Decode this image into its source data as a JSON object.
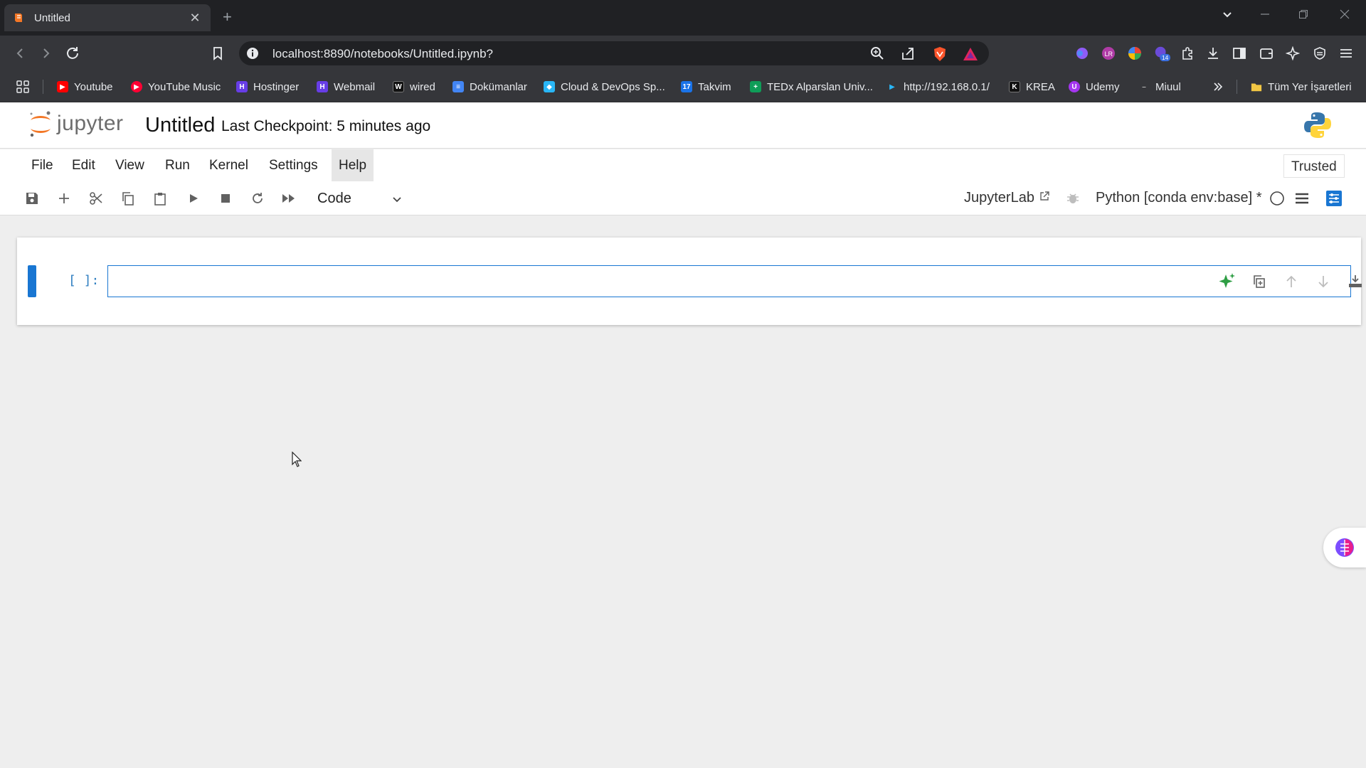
{
  "browser": {
    "tab": {
      "title": "Untitled"
    },
    "url": "localhost:8890/notebooks/Untitled.ipynb?",
    "extension_badge": "14",
    "bookmarks": [
      {
        "label": "Youtube",
        "icon": "youtube-icon",
        "color": "#ff0000"
      },
      {
        "label": "YouTube Music",
        "icon": "youtube-music-icon",
        "color": "#ff0033"
      },
      {
        "label": "Hostinger",
        "icon": "hostinger-icon",
        "color": "#673de6"
      },
      {
        "label": "Webmail",
        "icon": "webmail-icon",
        "color": "#673de6"
      },
      {
        "label": "wired",
        "icon": "wired-icon",
        "color": "#111111"
      },
      {
        "label": "Dokümanlar",
        "icon": "google-docs-icon",
        "color": "#4285f4"
      },
      {
        "label": "Cloud & DevOps Sp...",
        "icon": "cloud-devops-icon",
        "color": "#29b6f6"
      },
      {
        "label": "Takvim",
        "icon": "calendar-icon",
        "color": "#1a73e8"
      },
      {
        "label": "TEDx Alparslan Univ...",
        "icon": "google-sheets-icon",
        "color": "#0f9d58"
      },
      {
        "label": "http://192.168.0.1/",
        "icon": "router-icon",
        "color": "#29b6f6"
      },
      {
        "label": "KREA",
        "icon": "krea-icon",
        "color": "#111111"
      },
      {
        "label": "Udemy",
        "icon": "udemy-icon",
        "color": "#a435f0"
      },
      {
        "label": "Miuul",
        "icon": "miuul-icon",
        "color": "#333333"
      }
    ],
    "bookmarks_folder": "Tüm Yer İşaretleri"
  },
  "jupyter": {
    "logo_text": "jupyter",
    "notebook_title": "Untitled",
    "checkpoint": "Last Checkpoint: 5 minutes ago",
    "menu": [
      "File",
      "Edit",
      "View",
      "Run",
      "Kernel",
      "Settings",
      "Help"
    ],
    "trusted": "Trusted",
    "cell_type": "Code",
    "jupyterlab_link": "JupyterLab",
    "kernel": "Python [conda env:base] *",
    "cell": {
      "prompt": "[ ]:",
      "source": ""
    }
  },
  "colors": {
    "accent": "#1976d2",
    "prompt": "#307fc1",
    "jupyter_orange": "#f37726"
  }
}
